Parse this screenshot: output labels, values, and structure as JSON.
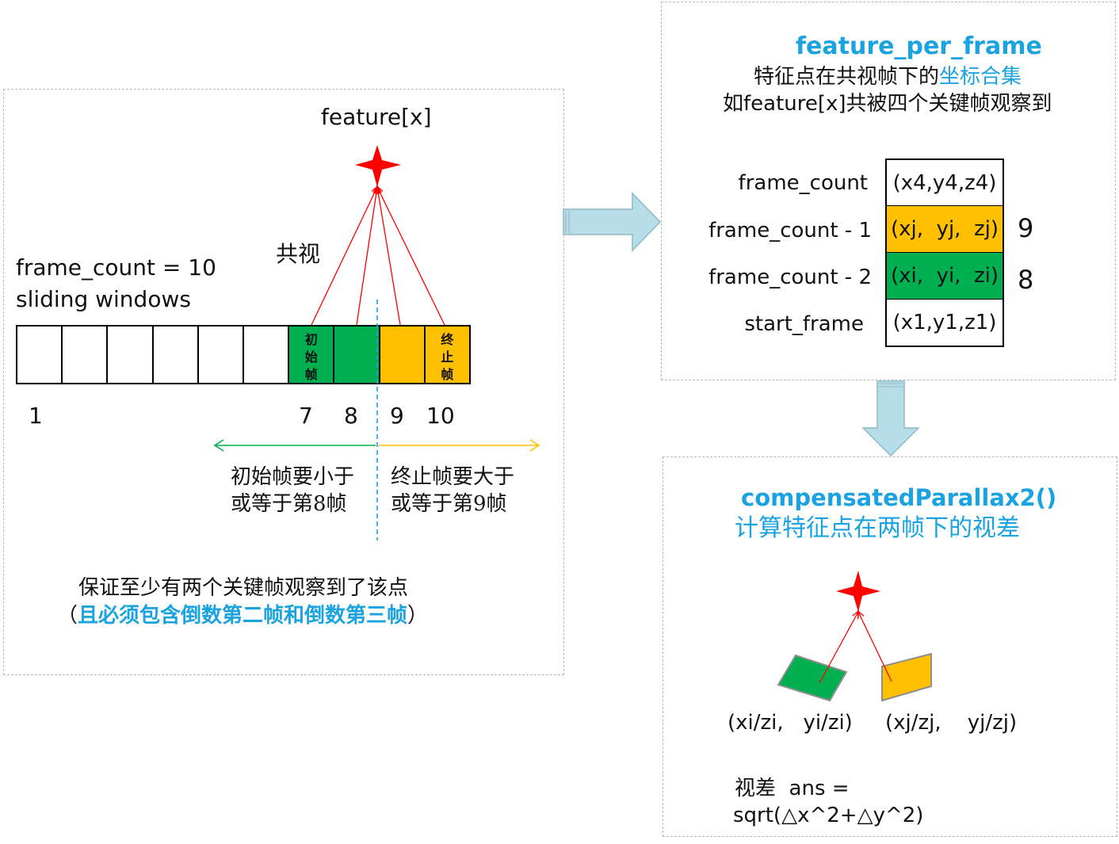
{
  "colors": {
    "green": "#00b050",
    "yellow": "#ffc000",
    "red": "#ff0000",
    "blue": "#1aa3e0",
    "arrow_fill": "#b7dde8",
    "arrow_stroke": "#8fb9c6"
  },
  "left_panel": {
    "feature_label": "feature[x]",
    "covis_label": "共视",
    "frame_count_text": "frame_count = 10",
    "sliding_text": "sliding windows",
    "cells": [
      {
        "chars": [],
        "color": "white"
      },
      {
        "chars": [],
        "color": "white"
      },
      {
        "chars": [],
        "color": "white"
      },
      {
        "chars": [],
        "color": "white"
      },
      {
        "chars": [],
        "color": "white"
      },
      {
        "chars": [],
        "color": "white"
      },
      {
        "chars": [
          "初",
          "始",
          "帧"
        ],
        "color": "green"
      },
      {
        "chars": [],
        "color": "green"
      },
      {
        "chars": [],
        "color": "yellow"
      },
      {
        "chars": [
          "终",
          "止",
          "帧"
        ],
        "color": "yellow"
      }
    ],
    "num_1": "1",
    "num_7": "7",
    "num_8": "8",
    "num_9": "9",
    "num_10": "10",
    "left_rule_line1": "初始帧要小于",
    "left_rule_line2": "或等于第8帧",
    "right_rule_line1": "终止帧要大于",
    "right_rule_line2": "或等于第9帧",
    "guarantee_line1": "保证至少有两个关键帧观察到了该点",
    "guarantee_line2_open": "（",
    "guarantee_line2_blue": "且必须包含倒数第二帧和倒数第三帧",
    "guarantee_line2_close": "）"
  },
  "top_right_panel": {
    "title": "feature_per_frame",
    "desc1_black": "特征点在共视帧下的",
    "desc1_blue": "坐标合集",
    "desc2": "如feature[x]共被四个关键帧观察到",
    "rows": [
      {
        "label": "frame_count",
        "value": "(x4,y4,z4)",
        "color": "white",
        "side": ""
      },
      {
        "label": "frame_count - 1",
        "value": "(xj,  yj,  zj)",
        "color": "yellow",
        "side": "9"
      },
      {
        "label": "frame_count - 2",
        "value": "(xi,  yi,  zi)",
        "color": "green",
        "side": "8"
      },
      {
        "label": "start_frame",
        "value": "(x1,y1,z1)",
        "color": "white",
        "side": ""
      }
    ]
  },
  "bottom_right_panel": {
    "title": "compensatedParallax2()",
    "subtitle": "计算特征点在两帧下的视差",
    "coord_left": "(xi/zi,   yi/zi)",
    "coord_right": "(xj/zj,    yj/zj)",
    "formula_line1": "视差  ans =",
    "formula_line2": "sqrt(△x^2+△y^2)"
  }
}
